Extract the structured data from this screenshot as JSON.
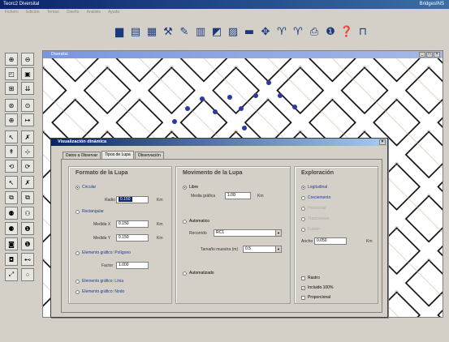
{
  "app": {
    "title": "Teorc2 Diversital",
    "right_text": "BridgesINS"
  },
  "menu": [
    "Fichero",
    "Edición",
    "Temas",
    "Diseño",
    "Análisis",
    "Ayuda"
  ],
  "map_window": {
    "title": "Diversital"
  },
  "dialog": {
    "title": "Visualización dinámica",
    "tabs": [
      "Datos a Observar",
      "Tipos de Lupa",
      "Observación"
    ],
    "active_tab": "Tipos de Lupa",
    "formato": {
      "heading": "Formato de la Lupa",
      "circular": "Circular",
      "radio_label": "Radio",
      "radio_value": "0.150",
      "km1": "Km",
      "rectangular": "Rectangular",
      "medida_x_label": "Medida X",
      "medida_x_value": "0.150",
      "km2": "Km",
      "medida_y_label": "Medida Y",
      "medida_y_value": "0.150",
      "km3": "Km",
      "poligono": "Elemento gráfico: Polígono",
      "factor_label": "Factor",
      "factor_value": "1.000",
      "linea": "Elemento gráfico: Línia",
      "nodo": "Elemento gráfico: Nodo"
    },
    "movimiento": {
      "heading": "Movimento de la Lupa",
      "libre": "Libre",
      "media_label": "Media gráfica",
      "media_value": "1.00",
      "km": "Km",
      "automatico": "Automatico",
      "recorrido_label": "Recorrido",
      "recorrido_value": "RC1",
      "tamano_label": "Tamaño muestra (m)",
      "tamano_value": "0.5",
      "automatizado": "Automatizado"
    },
    "exploracion": {
      "heading": "Exploración",
      "options": [
        "Logitudinal",
        "Creciemento",
        "Horizontal",
        "Transversal",
        "Fusión"
      ],
      "ancho_label": "Ancho",
      "ancho_value": "0.050",
      "km": "Km",
      "rastro": "Rastro",
      "incluido": "Incluido 100%",
      "proporcional": "Proporcional"
    }
  },
  "toolbar_icons": [
    "folder-icon",
    "save-icon",
    "layout-icon",
    "tools-icon",
    "edit-icon",
    "table-icon",
    "select-icon",
    "measure-icon",
    "film-icon",
    "network-icon",
    "filter-icon",
    "filter2-icon",
    "print-icon",
    "info-icon",
    "help-icon",
    "window-icon"
  ],
  "left_tool_icons": [
    "zoom-in-icon",
    "zoom-out-icon",
    "zoom-window-icon",
    "zoom-all-icon",
    "pan-icon",
    "refresh-icon",
    "zoom-center-icon",
    "zoom-extent-icon",
    "move-icon",
    "measure-icon",
    "select-icon",
    "delete-icon",
    "info-icon",
    "node-icon",
    "undo-icon",
    "redo-icon",
    "cut-icon",
    "delete-node-icon",
    "copy-icon",
    "paste-icon",
    "join-icon",
    "split-icon",
    "add-node-icon",
    "info2-icon",
    "break-icon",
    "snap-icon",
    "layers-icon",
    "table-icon",
    "curve-icon",
    "points-icon"
  ],
  "colors": {
    "title_bar": "#0a246a",
    "accent_text": "#1a3a9a"
  }
}
